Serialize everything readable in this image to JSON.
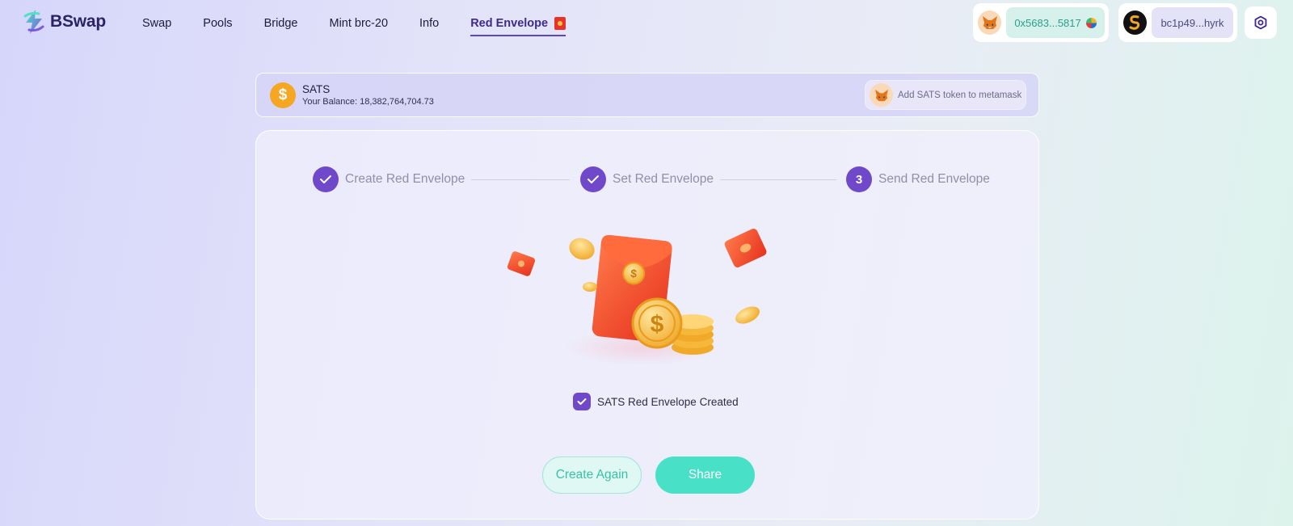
{
  "app": {
    "name": "BSwap"
  },
  "nav": {
    "items": [
      {
        "label": "Swap"
      },
      {
        "label": "Pools"
      },
      {
        "label": "Bridge"
      },
      {
        "label": "Mint brc-20"
      },
      {
        "label": "Info"
      },
      {
        "label": "Red Envelope",
        "active": true
      }
    ]
  },
  "wallets": {
    "evm": {
      "address": "0x5683...5817",
      "icon": "metamask-fox-icon"
    },
    "btc": {
      "address": "bc1p49...hyrk",
      "icon": "sats-logo-icon"
    }
  },
  "settings": {
    "icon": "settings-hex-icon"
  },
  "token": {
    "symbol": "SATS",
    "balance_label": "Your Balance: 18,382,764,704.73",
    "add_metamask_label": "Add SATS token to metamask"
  },
  "steps": [
    {
      "label": "Create Red Envelope",
      "status": "done"
    },
    {
      "label": "Set Red Envelope",
      "status": "done"
    },
    {
      "number": "3",
      "label": "Send Red Envelope",
      "status": "current"
    }
  ],
  "result": {
    "message": "SATS Red Envelope Created"
  },
  "actions": {
    "create_again": "Create Again",
    "share": "Share"
  },
  "colors": {
    "accent_purple": "#6f49c9",
    "accent_teal": "#49e0c8",
    "envelope_red": "#f04a2a",
    "coin_gold": "#f5b83a"
  }
}
